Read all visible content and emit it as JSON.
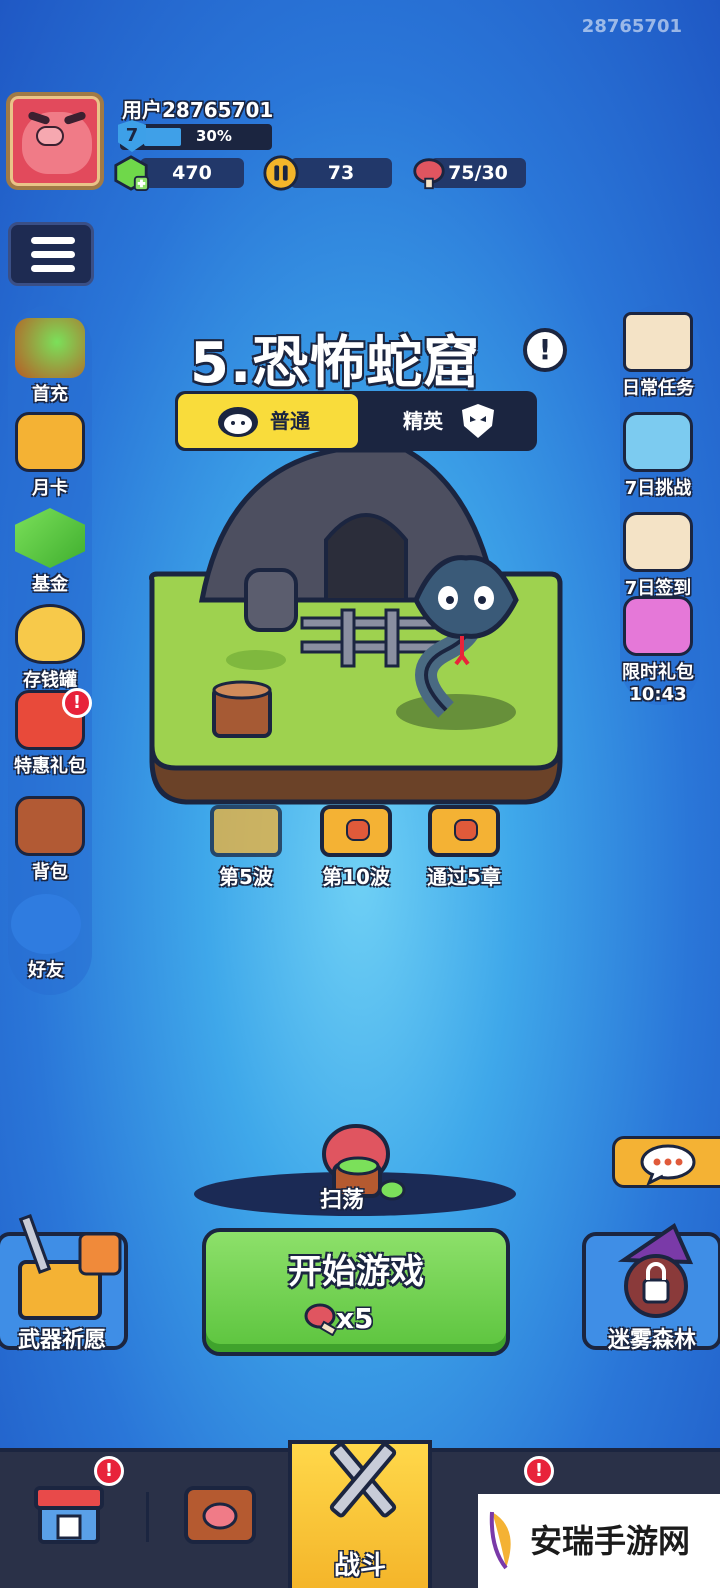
{
  "top_id": "28765701",
  "player": {
    "username": "用户28765701",
    "level": "7",
    "xp_percent": "30%",
    "xp_fraction": 0.3
  },
  "resources": {
    "gems": "470",
    "coins": "73",
    "meat": "75/30"
  },
  "left_menu": [
    {
      "label": "首充"
    },
    {
      "label": "月卡"
    },
    {
      "label": "基金"
    },
    {
      "label": "存钱罐"
    },
    {
      "label": "特惠礼包",
      "badge": "!"
    },
    {
      "label": "背包"
    },
    {
      "label": "好友"
    }
  ],
  "right_menu": [
    {
      "label": "日常任务"
    },
    {
      "label": "7日挑战"
    },
    {
      "label": "7日签到"
    },
    {
      "label": "限时礼包",
      "timer": "10:43"
    }
  ],
  "stage": {
    "title": "5.恐怖蛇窟",
    "info": "!",
    "difficulty_normal": "普通",
    "difficulty_elite": "精英"
  },
  "chests": [
    {
      "label": "第5波"
    },
    {
      "label": "第10波"
    },
    {
      "label": "通过5章"
    }
  ],
  "sweep_label": "扫荡",
  "start": {
    "label": "开始游戏",
    "cost": "x5"
  },
  "corners": {
    "left": "武器祈愿",
    "right": "迷雾森林"
  },
  "nav": {
    "battle": "战斗",
    "shop_badge": "!",
    "tab4_badge": "!"
  },
  "watermark": "安瑞手游网",
  "colors": {
    "accent_yellow": "#f9dc3b",
    "start_green": "#5cc43e",
    "badge_red": "#e8233a",
    "outline_navy": "#1b2540"
  }
}
